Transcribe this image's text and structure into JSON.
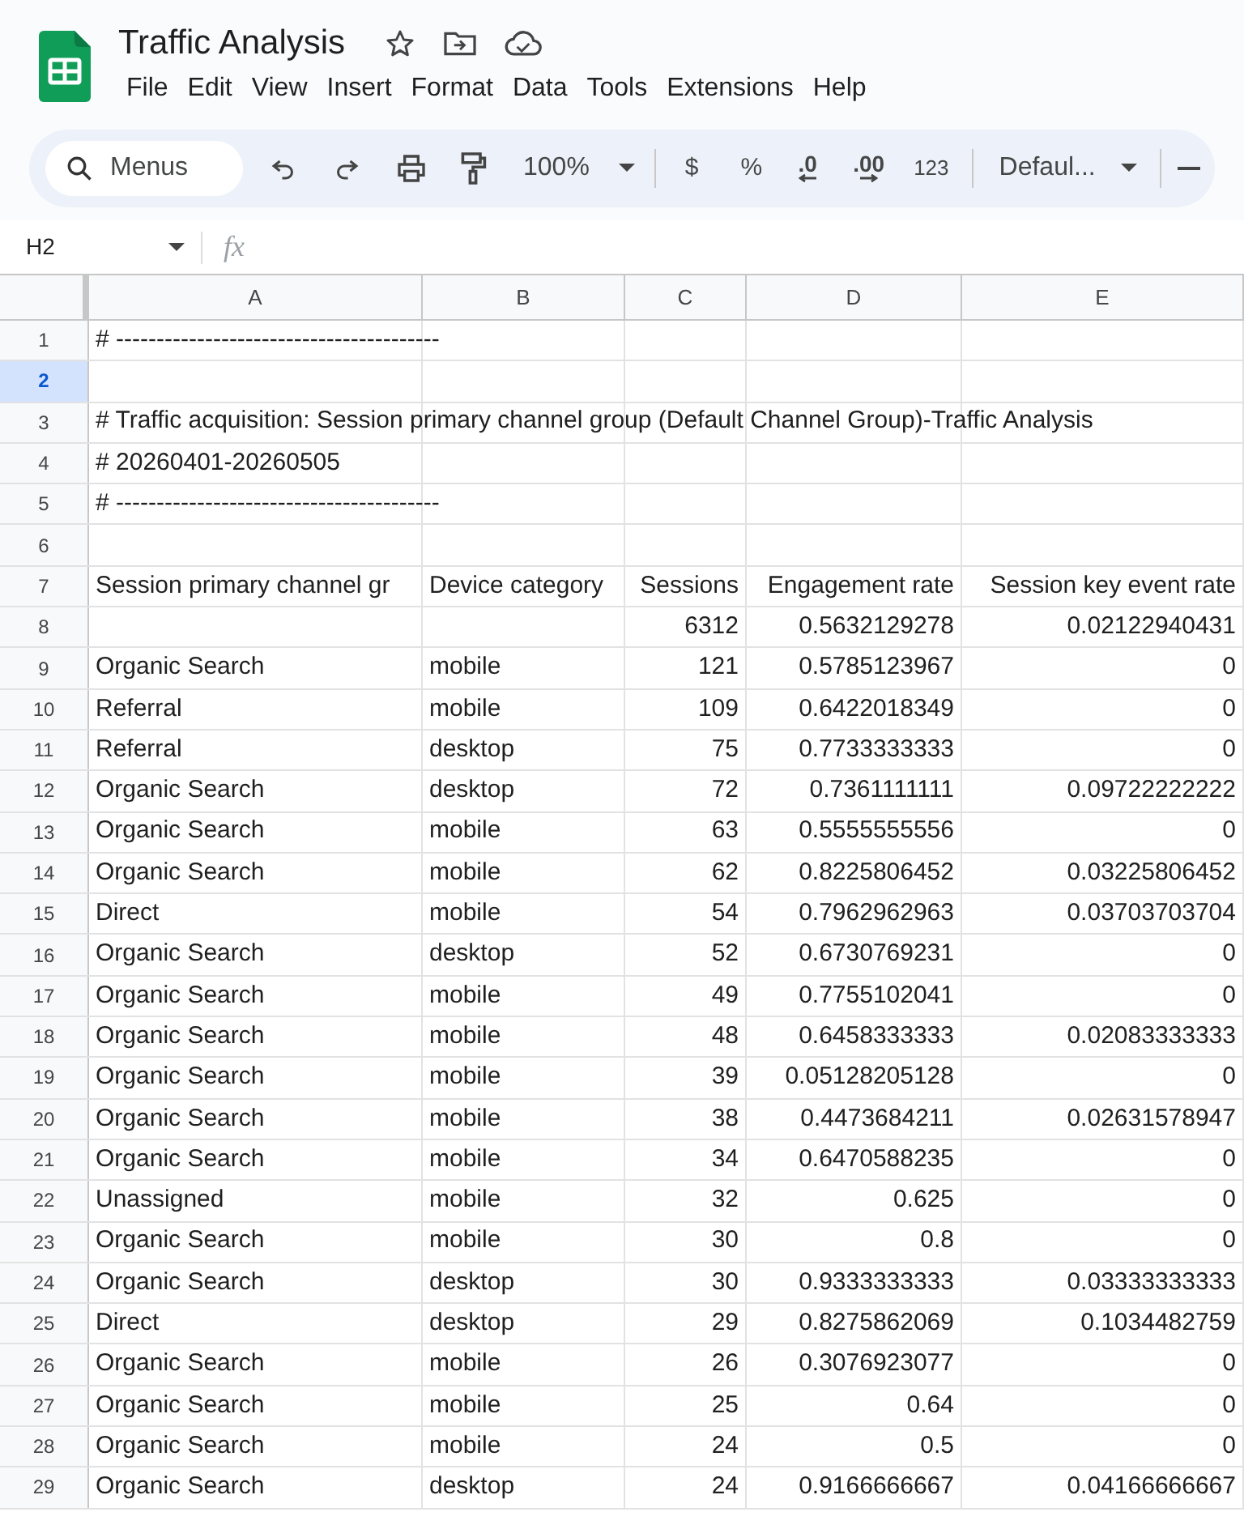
{
  "document": {
    "title": "Traffic Analysis"
  },
  "menu": [
    "File",
    "Edit",
    "View",
    "Insert",
    "Format",
    "Data",
    "Tools",
    "Extensions",
    "Help"
  ],
  "toolbar": {
    "search_label": "Menus",
    "zoom": "100%",
    "currency": "$",
    "percent": "%",
    "decrease_decimals": ".0",
    "increase_decimals": ".00",
    "number_format": "123",
    "font": "Defaul..."
  },
  "formula_bar": {
    "name_box": "H2",
    "fx": "fx"
  },
  "columns": [
    {
      "label": "A",
      "selected": false
    },
    {
      "label": "B",
      "selected": false
    },
    {
      "label": "C",
      "selected": false
    },
    {
      "label": "D",
      "selected": false
    },
    {
      "label": "E",
      "selected": false
    }
  ],
  "rows": [
    {
      "number": "1",
      "selected": false,
      "a": "# ----------------------------------------"
    },
    {
      "number": "2",
      "selected": true
    },
    {
      "number": "3",
      "selected": false,
      "a": "# Traffic acquisition: Session primary channel group (Default Channel Group)-Traffic Analysis"
    },
    {
      "number": "4",
      "selected": false,
      "a": "# 20260401-20260505"
    },
    {
      "number": "5",
      "selected": false,
      "a": "# ----------------------------------------"
    },
    {
      "number": "6",
      "selected": false
    },
    {
      "number": "7",
      "selected": false,
      "a": "Session primary channel gr",
      "b": "Device category",
      "c": "Sessions",
      "d": "Engagement rate",
      "e": "Session key event rate"
    },
    {
      "number": "8",
      "selected": false,
      "c": "6312",
      "d": "0.5632129278",
      "e": "0.02122940431"
    },
    {
      "number": "9",
      "selected": false,
      "a": "Organic Search",
      "b": "mobile",
      "c": "121",
      "d": "0.5785123967",
      "e": "0"
    },
    {
      "number": "10",
      "selected": false,
      "a": "Referral",
      "b": "mobile",
      "c": "109",
      "d": "0.6422018349",
      "e": "0"
    },
    {
      "number": "11",
      "selected": false,
      "a": "Referral",
      "b": "desktop",
      "c": "75",
      "d": "0.7733333333",
      "e": "0"
    },
    {
      "number": "12",
      "selected": false,
      "a": "Organic Search",
      "b": "desktop",
      "c": "72",
      "d": "0.7361111111",
      "e": "0.09722222222"
    },
    {
      "number": "13",
      "selected": false,
      "a": "Organic Search",
      "b": "mobile",
      "c": "63",
      "d": "0.5555555556",
      "e": "0"
    },
    {
      "number": "14",
      "selected": false,
      "a": "Organic Search",
      "b": "mobile",
      "c": "62",
      "d": "0.8225806452",
      "e": "0.03225806452"
    },
    {
      "number": "15",
      "selected": false,
      "a": "Direct",
      "b": "mobile",
      "c": "54",
      "d": "0.7962962963",
      "e": "0.03703703704"
    },
    {
      "number": "16",
      "selected": false,
      "a": "Organic Search",
      "b": "desktop",
      "c": "52",
      "d": "0.6730769231",
      "e": "0"
    },
    {
      "number": "17",
      "selected": false,
      "a": "Organic Search",
      "b": "mobile",
      "c": "49",
      "d": "0.7755102041",
      "e": "0"
    },
    {
      "number": "18",
      "selected": false,
      "a": "Organic Search",
      "b": "mobile",
      "c": "48",
      "d": "0.6458333333",
      "e": "0.02083333333"
    },
    {
      "number": "19",
      "selected": false,
      "a": "Organic Search",
      "b": "mobile",
      "c": "39",
      "d": "0.05128205128",
      "e": "0"
    },
    {
      "number": "20",
      "selected": false,
      "a": "Organic Search",
      "b": "mobile",
      "c": "38",
      "d": "0.4473684211",
      "e": "0.02631578947"
    },
    {
      "number": "21",
      "selected": false,
      "a": "Organic Search",
      "b": "mobile",
      "c": "34",
      "d": "0.6470588235",
      "e": "0"
    },
    {
      "number": "22",
      "selected": false,
      "a": "Unassigned",
      "b": "mobile",
      "c": "32",
      "d": "0.625",
      "e": "0"
    },
    {
      "number": "23",
      "selected": false,
      "a": "Organic Search",
      "b": "mobile",
      "c": "30",
      "d": "0.8",
      "e": "0"
    },
    {
      "number": "24",
      "selected": false,
      "a": "Organic Search",
      "b": "desktop",
      "c": "30",
      "d": "0.9333333333",
      "e": "0.03333333333"
    },
    {
      "number": "25",
      "selected": false,
      "a": "Direct",
      "b": "desktop",
      "c": "29",
      "d": "0.8275862069",
      "e": "0.1034482759"
    },
    {
      "number": "26",
      "selected": false,
      "a": "Organic Search",
      "b": "mobile",
      "c": "26",
      "d": "0.3076923077",
      "e": "0"
    },
    {
      "number": "27",
      "selected": false,
      "a": "Organic Search",
      "b": "mobile",
      "c": "25",
      "d": "0.64",
      "e": "0"
    },
    {
      "number": "28",
      "selected": false,
      "a": "Organic Search",
      "b": "mobile",
      "c": "24",
      "d": "0.5",
      "e": "0"
    },
    {
      "number": "29",
      "selected": false,
      "a": "Organic Search",
      "b": "desktop",
      "c": "24",
      "d": "0.9166666667",
      "e": "0.04166666667"
    }
  ]
}
